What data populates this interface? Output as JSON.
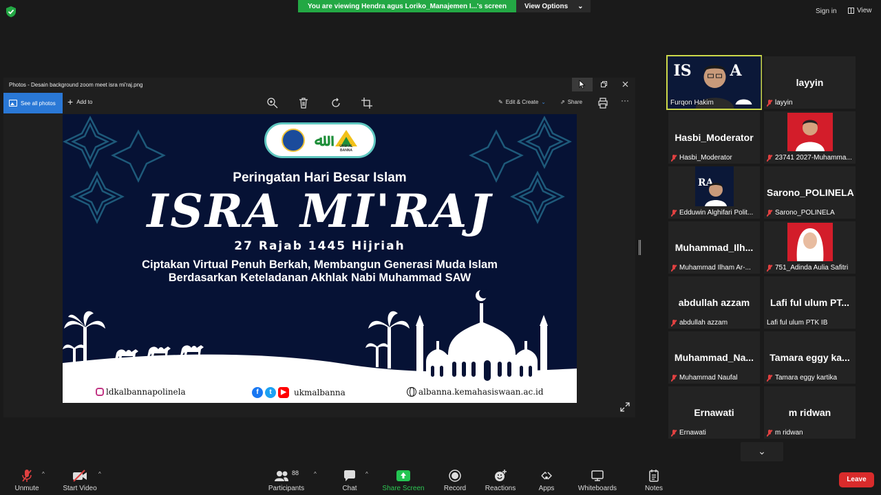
{
  "topbar": {
    "banner_text": "You are viewing Hendra agus Loriko_Manajemen I...'s screen",
    "view_options": "View Options",
    "sign_in": "Sign in",
    "view": "View"
  },
  "photos": {
    "window_title": "Photos - Desain background zoom meet isra mi'raj.png",
    "see_all": "See all photos",
    "add_to": "Add to",
    "edit_create": "Edit & Create",
    "share": "Share"
  },
  "poster": {
    "subtitle": "Peringatan Hari Besar Islam",
    "title": "ISRA MI'RAJ",
    "date": "27 Rajab 1445 Hijriah",
    "theme_line1": "Ciptakan Virtual Penuh Berkah, Membangun Generasi Muda Islam",
    "theme_line2": "Berdasarkan Keteladanan Akhlak Nabi Muhammad SAW",
    "logo_caption": "UKM AL BANNA",
    "instagram": "ldkalbannapolinela",
    "socials": "ukmalbanna",
    "website": "albanna.kemahasiswaan.ac.id"
  },
  "participants": [
    {
      "big": "",
      "label": "Furqon Hakim",
      "muted": false
    },
    {
      "big": "layyin",
      "label": "layyin",
      "muted": true
    },
    {
      "big": "Hasbi_Moderator",
      "label": "Hasbi_Moderator",
      "muted": true
    },
    {
      "big": "",
      "label": "23741 2027-Muhamma...",
      "muted": true
    },
    {
      "big": "",
      "label": "Edduwin Alghifari Polit...",
      "muted": true
    },
    {
      "big": "Sarono_POLINELA",
      "label": "Sarono_POLINELA",
      "muted": true
    },
    {
      "big": "Muhammad_Ilh...",
      "label": "Muhammad Ilham Ar-...",
      "muted": true
    },
    {
      "big": "",
      "label": "751_Adinda Aulia Safitri",
      "muted": true
    },
    {
      "big": "abdullah azzam",
      "label": "abdullah azzam",
      "muted": true
    },
    {
      "big": "Lafi ful ulum PT...",
      "label": "Lafi ful ulum PTK IB",
      "muted": false
    },
    {
      "big": "Muhammad_Na...",
      "label": "Muhammad Naufal",
      "muted": true
    },
    {
      "big": "Tamara eggy ka...",
      "label": "Tamara eggy kartika",
      "muted": true
    },
    {
      "big": "Ernawati",
      "label": "Ernawati",
      "muted": true
    },
    {
      "big": "m ridwan",
      "label": "m ridwan",
      "muted": true
    }
  ],
  "toolbar": {
    "unmute": "Unmute",
    "start_video": "Start Video",
    "participants": "Participants",
    "participant_count": "88",
    "chat": "Chat",
    "share_screen": "Share Screen",
    "record": "Record",
    "reactions": "Reactions",
    "apps": "Apps",
    "whiteboards": "Whiteboards",
    "notes": "Notes",
    "leave": "Leave"
  },
  "colors": {
    "banner_green": "#23a844",
    "poster_navy": "#061235",
    "leave_red": "#d92b2b",
    "active_speaker": "#cdd94a"
  }
}
